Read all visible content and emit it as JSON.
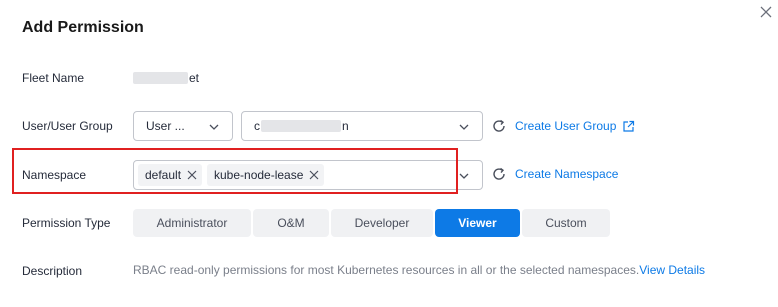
{
  "dialog": {
    "title": "Add Permission"
  },
  "fields": {
    "fleet_name_label": "Fleet Name",
    "fleet_name_suffix": "et",
    "user_group_label": "User/User Group",
    "user_type_value": "User ...",
    "user_name_prefix": "c",
    "user_name_suffix": "n",
    "create_user_group_link": "Create User Group",
    "namespace_label": "Namespace",
    "namespace_tags": [
      "default",
      "kube-node-lease"
    ],
    "create_namespace_link": "Create Namespace",
    "permission_type_label": "Permission Type",
    "permission_types": [
      "Administrator",
      "O&M",
      "Developer",
      "Viewer",
      "Custom"
    ],
    "selected_permission": "Viewer",
    "description_label": "Description",
    "description_text": "RBAC read-only permissions for most Kubernetes resources in all or the selected namespaces.",
    "view_details_link": "View Details"
  },
  "colors": {
    "accent": "#0d7ae6",
    "highlight": "#e02020"
  }
}
